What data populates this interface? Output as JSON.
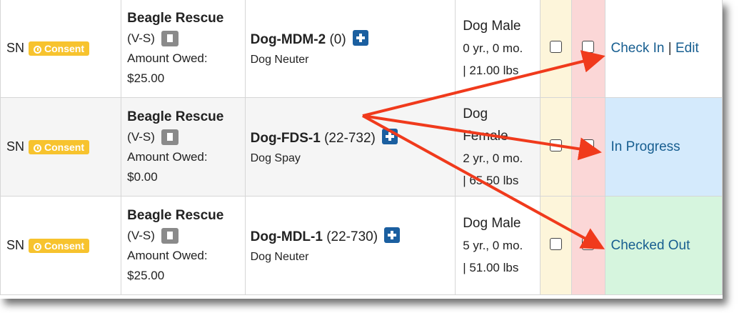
{
  "rows": [
    {
      "type": "SN",
      "consent": "Consent",
      "owner": "Beagle Rescue",
      "owner_tag": "(V-S)",
      "amount_label": "Amount Owed:",
      "amount": "$25.00",
      "pet_name": "Dog-MDM-2",
      "pet_id": "(0)",
      "service": "Dog Neuter",
      "signalment": "Dog Male",
      "age": "0 yr., 0 mo.",
      "weight": "| 21.00 lbs",
      "status_primary": "Check In",
      "status_sep": "|",
      "status_secondary": "Edit"
    },
    {
      "type": "SN",
      "consent": "Consent",
      "owner": "Beagle Rescue",
      "owner_tag": "(V-S)",
      "amount_label": "Amount Owed:",
      "amount": "$0.00",
      "pet_name": "Dog-FDS-1",
      "pet_id": "(22-732)",
      "service": "Dog Spay",
      "signalment_a": "Dog",
      "signalment_b": "Female",
      "age": "2 yr., 0 mo.",
      "weight": "| 65.50 lbs",
      "status_primary": "In Progress"
    },
    {
      "type": "SN",
      "consent": "Consent",
      "owner": "Beagle Rescue",
      "owner_tag": "(V-S)",
      "amount_label": "Amount Owed:",
      "amount": "$25.00",
      "pet_name": "Dog-MDL-1",
      "pet_id": "(22-730)",
      "service": "Dog Neuter",
      "signalment": "Dog Male",
      "age": "5 yr., 0 mo.",
      "weight": "| 51.00 lbs",
      "status_primary": "Checked Out"
    }
  ],
  "colors": {
    "consent": "#f7c32e",
    "link": "#175e90",
    "arrow": "#f03a1c",
    "in_progress_bg": "#d4eafc",
    "checked_out_bg": "#d6f5de"
  },
  "icons": [
    "clock-icon",
    "document-icon",
    "plus-icon",
    "checkbox",
    "arrow"
  ]
}
